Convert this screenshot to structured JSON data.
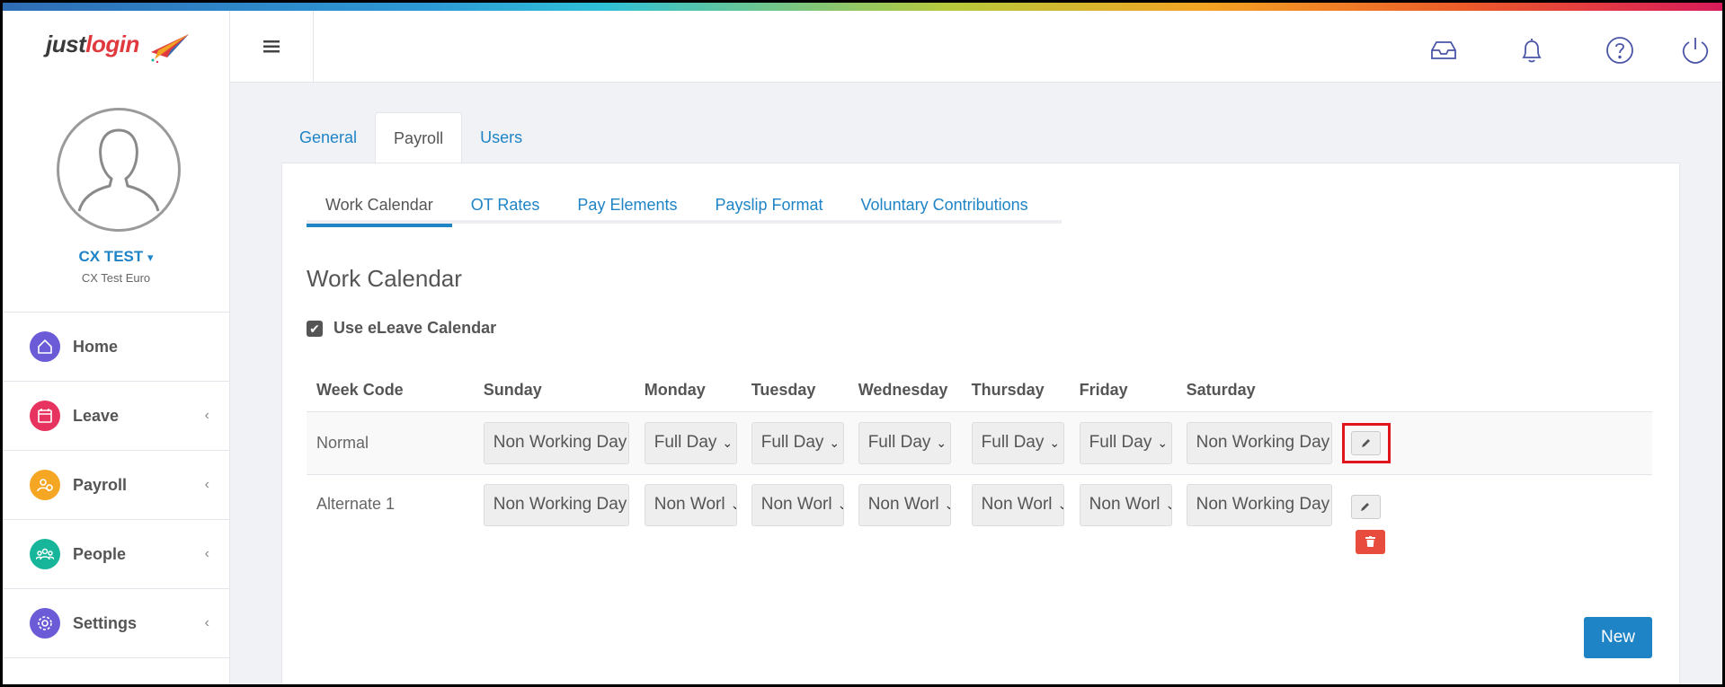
{
  "header": {
    "logo_just": "just",
    "logo_login": "login",
    "icons": [
      "menu-icon",
      "inbox-icon",
      "bell-icon",
      "help-icon",
      "power-icon"
    ]
  },
  "profile": {
    "name": "CX TEST",
    "caret": "▾",
    "subtitle": "CX Test Euro"
  },
  "sidebar": {
    "items": [
      {
        "label": "Home",
        "icon": "home-icon",
        "color": "#6b5bd6",
        "chevron": ""
      },
      {
        "label": "Leave",
        "icon": "calendar-icon",
        "color": "#e6335f",
        "chevron": "‹"
      },
      {
        "label": "Payroll",
        "icon": "payroll-icon",
        "color": "#f5a623",
        "chevron": "‹"
      },
      {
        "label": "People",
        "icon": "people-icon",
        "color": "#17b59a",
        "chevron": "‹"
      },
      {
        "label": "Settings",
        "icon": "gear-icon",
        "color": "#6b5bd6",
        "chevron": "‹"
      }
    ]
  },
  "tabs": [
    "General",
    "Payroll",
    "Users"
  ],
  "subtabs": [
    "Work Calendar",
    "OT Rates",
    "Pay Elements",
    "Payslip Format",
    "Voluntary Contributions"
  ],
  "section_title": "Work Calendar",
  "checkbox": {
    "label": "Use eLeave Calendar",
    "checked": true,
    "mark": "✔"
  },
  "table": {
    "headers": [
      "Week Code",
      "Sunday",
      "Monday",
      "Tuesday",
      "Wednesday",
      "Thursday",
      "Friday",
      "Saturday"
    ],
    "rows": [
      {
        "code": "Normal",
        "days": [
          "Non Working Day",
          "Full Day",
          "Full Day",
          "Full Day",
          "Full Day",
          "Full Day",
          "Non Working Day"
        ]
      },
      {
        "code": "Alternate 1",
        "days": [
          "Non Working Day",
          "Non Worl",
          "Non Worl",
          "Non Worl",
          "Non Worl",
          "Non Worl",
          "Non Working Day"
        ]
      }
    ]
  },
  "new_button": "New",
  "colors": {
    "accent": "#1f84c6",
    "danger": "#e74c3c",
    "highlight": "#e0141c"
  }
}
